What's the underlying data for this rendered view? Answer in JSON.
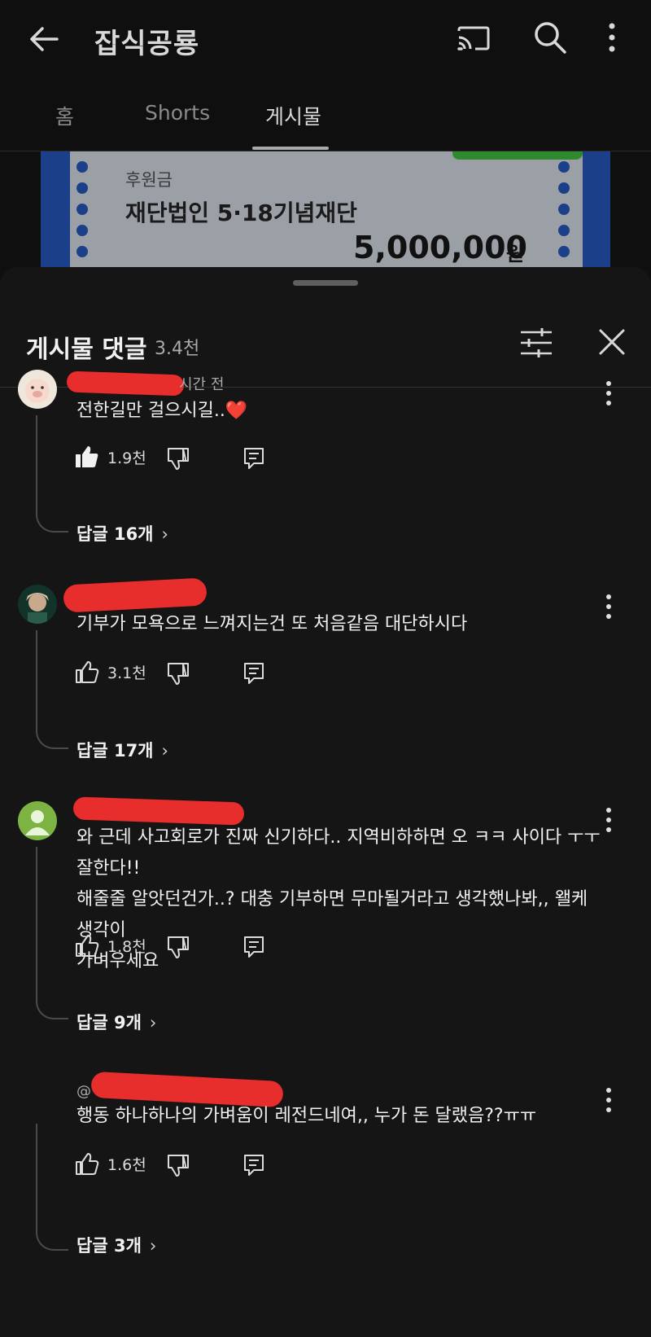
{
  "appbar": {
    "title": "잡식공룡",
    "icons": [
      "back-arrow-icon",
      "cast-icon",
      "search-icon",
      "more-vert-icon"
    ]
  },
  "tabs": [
    {
      "label": "홈",
      "active": false
    },
    {
      "label": "Shorts",
      "active": false
    },
    {
      "label": "게시물",
      "active": true
    }
  ],
  "card": {
    "label": "후원금",
    "name": "재단법인 5·18기념재단",
    "amount": "5,000,000",
    "unit": "원"
  },
  "sheet": {
    "title": "게시물 댓글",
    "count": "3.4천"
  },
  "comments": [
    {
      "time_fragment": "시간 전",
      "text": [
        "전한길만 걸으시길..❤️"
      ],
      "likes": "1.9천",
      "liked": true,
      "replies": "답글 16개"
    },
    {
      "time_fragment": "",
      "text": [
        "기부가 모욕으로 느껴지는건 또 처음같음 대단하시다"
      ],
      "likes": "3.1천",
      "liked": false,
      "replies": "답글 17개"
    },
    {
      "time_fragment": "",
      "text": [
        "와 근데 사고회로가 진짜 신기하다.. 지역비하하면 오 ㅋㅋ 사이다 ㅜㅜ 잘한다!!",
        "해줄줄 알앗던건가..? 대충 기부하면 무마될거라고 생각했나봐,, 왤케 생각이",
        "가벼우세요"
      ],
      "likes": "1.8천",
      "liked": false,
      "replies": "답글 9개"
    },
    {
      "time_fragment": "@",
      "text": [
        "행동 하나하나의 가벼움이 레전드네여,, 누가 돈 달랬음??ㅠㅠ"
      ],
      "likes": "1.6천",
      "liked": false,
      "replies": "답글 3개"
    }
  ]
}
